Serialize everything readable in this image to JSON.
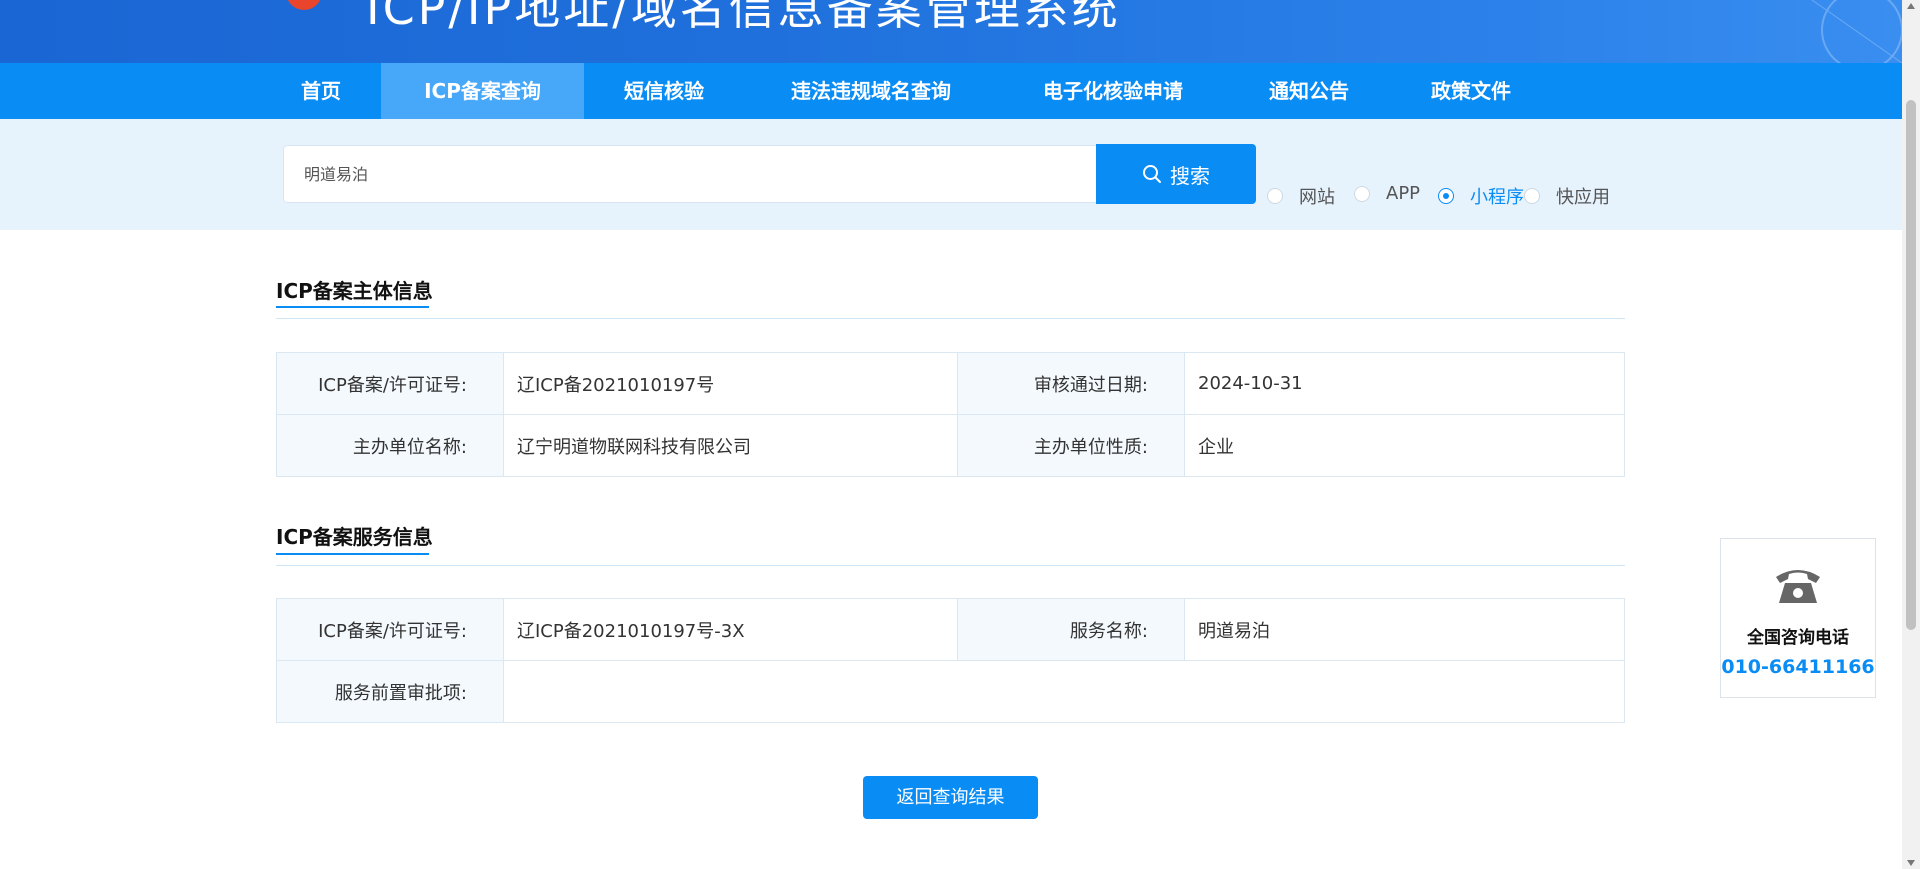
{
  "header": {
    "title": "ICP/IP地址/域名信息备案管理系统"
  },
  "nav": {
    "items": [
      {
        "label": "首页",
        "active": false
      },
      {
        "label": "ICP备案查询",
        "active": true
      },
      {
        "label": "短信核验",
        "active": false
      },
      {
        "label": "违法违规域名查询",
        "active": false
      },
      {
        "label": "电子化核验申请",
        "active": false
      },
      {
        "label": "通知公告",
        "active": false
      },
      {
        "label": "政策文件",
        "active": false
      }
    ]
  },
  "search": {
    "value": "明道易泊",
    "button_label": "搜索",
    "types": [
      {
        "label": "网站",
        "checked": false
      },
      {
        "label": "APP",
        "checked": false
      },
      {
        "label": "小程序",
        "checked": true
      },
      {
        "label": "快应用",
        "checked": false
      }
    ]
  },
  "subject": {
    "heading": "ICP备案主体信息",
    "rows": [
      {
        "label1": "ICP备案/许可证号:",
        "value1": "辽ICP备2021010197号",
        "label2": "审核通过日期:",
        "value2": "2024-10-31"
      },
      {
        "label1": "主办单位名称:",
        "value1": "辽宁明道物联网科技有限公司",
        "label2": "主办单位性质:",
        "value2": "企业"
      }
    ]
  },
  "service": {
    "heading": "ICP备案服务信息",
    "row1": {
      "label1": "ICP备案/许可证号:",
      "value1": "辽ICP备2021010197号-3X",
      "label2": "服务名称:",
      "value2": "明道易泊"
    },
    "row2": {
      "label": "服务前置审批项:",
      "value": ""
    }
  },
  "actions": {
    "back_label": "返回查询结果"
  },
  "hotline": {
    "label": "全国咨询电话",
    "number": "010-66411166"
  },
  "colors": {
    "primary": "#0a8cf5",
    "nav_active": "#47a7f8",
    "search_strip": "#e6f3fd",
    "label_cell": "#f4f9fd"
  }
}
